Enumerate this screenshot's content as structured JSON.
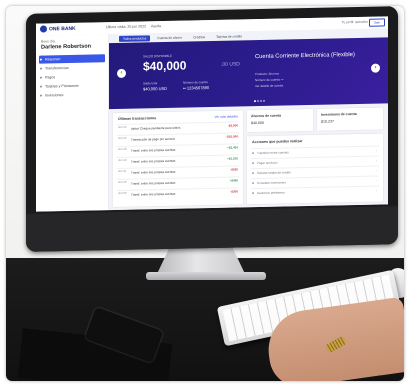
{
  "brand": {
    "name": "ONE BANK",
    "accent": "#3a57e8",
    "hero_color": "#23197a",
    "negative": "#d33b3b",
    "positive": "#2f9e5a"
  },
  "topbar": {
    "nav": [
      "Última visita: 25 jun 2022",
      "Ayuda"
    ],
    "user_label": "Tu perfil: operativo",
    "exit_label": "Salir"
  },
  "sidebar": {
    "greeting": "Buen día,",
    "user_name": "Darlene Robertson",
    "items": [
      {
        "label": "Resumen",
        "active": true
      },
      {
        "label": "Transferencias",
        "active": false
      },
      {
        "label": "Pagos",
        "active": false
      },
      {
        "label": "Tarjetas y Préstamos",
        "active": false
      },
      {
        "label": "Inversiones",
        "active": false
      }
    ]
  },
  "tabs": [
    {
      "label": "Todos productos",
      "active": true
    },
    {
      "label": "Cuenta de ahorro",
      "active": false
    },
    {
      "label": "Créditos",
      "active": false
    },
    {
      "label": "Tarjetas de crédito",
      "active": false
    }
  ],
  "hero": {
    "left": {
      "label": "SALDO DISPONIBLE",
      "amount": "$40,000",
      "cents": ",00 USD",
      "sub1_label": "Saldo total",
      "sub1_value": "$40,000 USD",
      "sub2_label": "Número de cuenta",
      "sub2_value": "•• 1234567890"
    },
    "right": {
      "title": "Cuenta Corriente Electrónica (Flexible)",
      "lines": [
        "Producto: Ahorros",
        "Número de cuenta: ••",
        "Ver detalle de cuenta"
      ]
    },
    "prev_icon": "‹",
    "next_icon": "›"
  },
  "transactions": {
    "title": "Últimas transacciones",
    "link": "Ver más detalles",
    "rows": [
      {
        "date": "Jun 14",
        "desc": "Aplicó Cheque pendiente para retiros",
        "amount": "-$3,000",
        "neg": true
      },
      {
        "date": "Jun 14",
        "desc": "Transacción de pago por servicio",
        "amount": "-$10,000",
        "neg": true
      },
      {
        "date": "Jun 13",
        "desc": "Transf. entre mis propias cuentas",
        "amount": "+$2,400",
        "neg": false
      },
      {
        "date": "Jun 12",
        "desc": "Transf. entre mis propias cuentas",
        "amount": "+$1,250",
        "neg": false
      },
      {
        "date": "Jun 11",
        "desc": "Transf. entre mis propias cuentas",
        "amount": "-$520",
        "neg": true
      },
      {
        "date": "Jun 10",
        "desc": "Transf. entre mis propias cuentas",
        "amount": "+$480",
        "neg": false
      },
      {
        "date": "Jun 09",
        "desc": "Transf. entre mis propias cuentas",
        "amount": "-$300",
        "neg": true
      }
    ]
  },
  "side_panels": {
    "balance_title": "Ahorros de cuenta",
    "balance_value": "$40,000",
    "investment_title": "Inversiones de cuenta",
    "investment_value": "$10,237",
    "actions_title": "Acciones que puedes realizar",
    "actions": [
      "Transferir entre cuentas",
      "Pagar servicios",
      "Solicitar tarjeta de crédito",
      "Consultar inversiones",
      "Gestionar préstamos"
    ]
  }
}
